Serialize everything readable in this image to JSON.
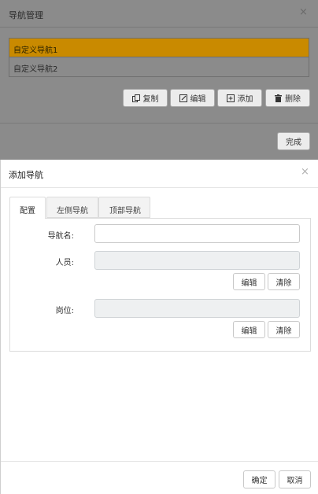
{
  "background_dialog": {
    "title": "导航管理",
    "close_glyph": "×",
    "list_items": [
      {
        "label": "自定义导航1",
        "selected": true
      },
      {
        "label": "自定义导航2",
        "selected": false
      }
    ],
    "toolbar": {
      "copy": "复制",
      "edit": "编辑",
      "add": "添加",
      "delete": "删除"
    },
    "finish": "完成",
    "selected_color": "#e8a000"
  },
  "dialog": {
    "title": "添加导航",
    "close_glyph": "×",
    "tabs": [
      "配置",
      "左侧导航",
      "顶部导航"
    ],
    "active_tab": 0,
    "form": {
      "name_label": "导航名:",
      "name_value": "",
      "person_label": "人员:",
      "person_value": "",
      "person_edit": "编辑",
      "person_clear": "清除",
      "post_label": "岗位:",
      "post_value": "",
      "post_edit": "编辑",
      "post_clear": "清除"
    },
    "footer": {
      "ok": "确定",
      "cancel": "取消"
    }
  }
}
